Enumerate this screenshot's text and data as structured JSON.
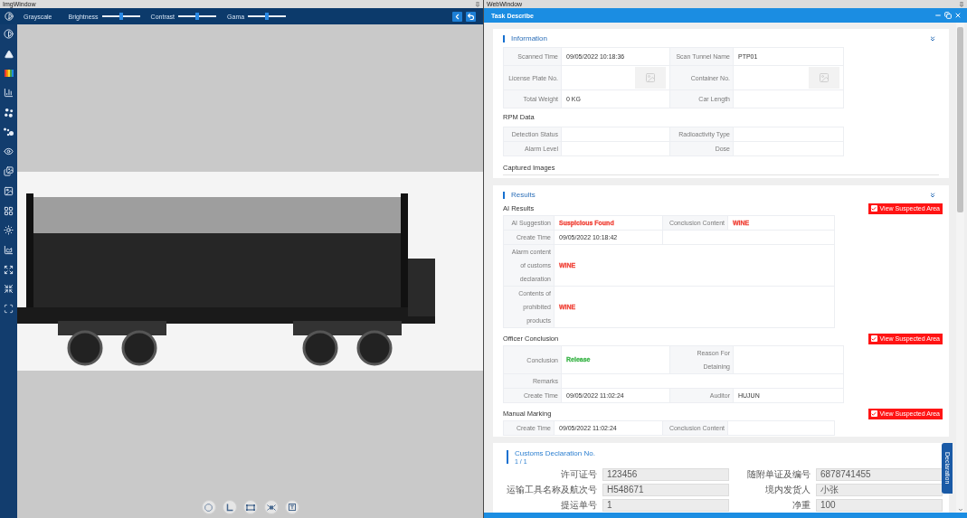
{
  "img_window": {
    "title": "ImgWindow",
    "toolbar": {
      "mode": "Grayscale",
      "sliders": [
        {
          "label": "Brightness",
          "level": 0.5
        },
        {
          "label": "Contrast",
          "level": 0.5
        },
        {
          "label": "Gama",
          "level": 0.5
        }
      ]
    }
  },
  "web_window": {
    "title": "WebWindow",
    "header": "Task Describe",
    "information": {
      "title": "Information",
      "rows": [
        {
          "kind": "pair",
          "fields": [
            {
              "label": "Scanned Time",
              "value": "09/05/2022 10:18:36"
            },
            {
              "label": "Scan Tunnel Name",
              "value": "PTP01"
            }
          ]
        },
        {
          "kind": "pair",
          "fields": [
            {
              "label": "License Plate No.",
              "thumbnail": true
            },
            {
              "label": "Container No.",
              "thumbnail": true
            }
          ]
        },
        {
          "kind": "pair",
          "fields": [
            {
              "label": "Total Weight",
              "value": "0 KG"
            },
            {
              "label": "Car Length"
            }
          ]
        }
      ],
      "rpm": {
        "title": "RPM Data",
        "rows": [
          {
            "kind": "pair",
            "fields": [
              {
                "label": "Detection Status"
              },
              {
                "label": "Radioactivity Type"
              }
            ]
          },
          {
            "kind": "pair",
            "fields": [
              {
                "label": "Alarm Level"
              },
              {
                "label": "Dose"
              }
            ]
          }
        ]
      },
      "captured_images": "Captured Images"
    },
    "results": {
      "title": "Results",
      "sections": [
        {
          "title": "AI Results",
          "button": {
            "label": "View Suspected Area",
            "checked": true
          },
          "rows": [
            {
              "kind": "pair",
              "fields": [
                {
                  "label": "AI Suggestion",
                  "value": "Suspicious Found",
                  "color": "#f0453a"
                },
                {
                  "label": "Conclusion Content",
                  "value": "WINE",
                  "color": "#f0453a"
                }
              ]
            },
            {
              "kind": "pair",
              "fields": [
                {
                  "label": "Create Time",
                  "value": "09/05/2022 10:18:42"
                }
              ]
            },
            {
              "kind": "wide",
              "fields": [
                {
                  "label": "Alarm content of customs declaration",
                  "value": "WINE",
                  "color": "#f0453a"
                }
              ]
            },
            {
              "kind": "wide",
              "fields": [
                {
                  "label": "Contents of prohibited products",
                  "value": "WINE",
                  "color": "#f0453a"
                }
              ]
            }
          ]
        },
        {
          "title": "Officer Conclusion",
          "button": {
            "label": "View Suspected Area",
            "checked": true
          },
          "rows": [
            {
              "kind": "pair",
              "fields": [
                {
                  "label": "Conclusion",
                  "value": "Release",
                  "color": "#3cb54a"
                },
                {
                  "label": "Reason For Detaining"
                }
              ]
            },
            {
              "kind": "wide",
              "fields": [
                {
                  "label": "Remarks"
                }
              ]
            },
            {
              "kind": "pair",
              "fields": [
                {
                  "label": "Create Time",
                  "value": "09/05/2022 11:02:24"
                },
                {
                  "label": "Auditor",
                  "value": "HUJUN"
                }
              ]
            }
          ]
        },
        {
          "title": "Manual Marking",
          "button": {
            "label": "View Suspected Area",
            "checked": true
          },
          "rows": [
            {
              "kind": "pair",
              "fields": [
                {
                  "label": "Create Time",
                  "value": "09/05/2022 11:02:24"
                },
                {
                  "label": "Conclusion Content"
                }
              ]
            }
          ]
        }
      ]
    },
    "customs_declaration": {
      "title": "Customs Declaration No.",
      "page": "1 / 1",
      "fields": [
        {
          "label": "许可证号",
          "value": "123456"
        },
        {
          "label": "随附单证及编号",
          "value": "6878741455"
        },
        {
          "label": "运输工具名称及航次号",
          "value": "H548671"
        },
        {
          "label": "境内发货人",
          "value": "小张"
        },
        {
          "label": "提运单号",
          "value": "1"
        },
        {
          "label": "净重",
          "value": "100"
        }
      ]
    },
    "side_tab": "Declaration"
  }
}
